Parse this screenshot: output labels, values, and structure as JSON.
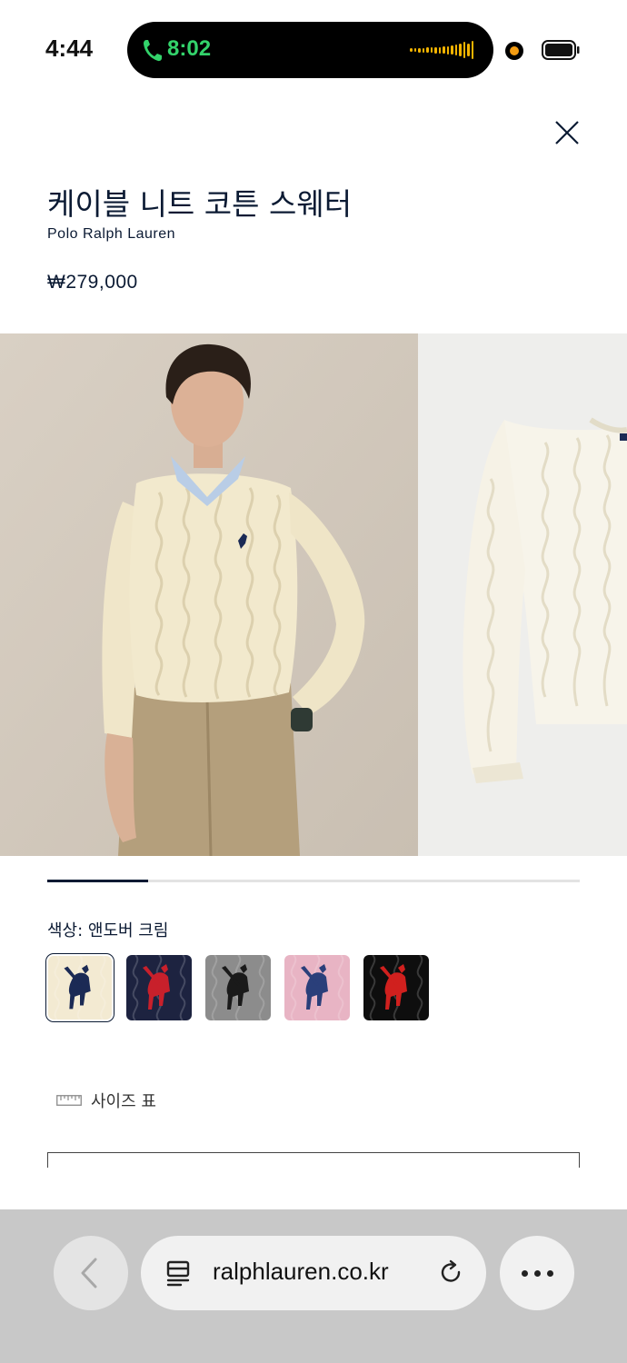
{
  "status_bar": {
    "time": "4:44",
    "call_time": "8:02"
  },
  "product": {
    "title": "케이블 니트 코튼 스웨터",
    "brand": "Polo Ralph Lauren",
    "price": "₩279,000"
  },
  "gallery": {
    "progress": 0.19
  },
  "color": {
    "label": "색상: 앤도버 크림",
    "swatches": [
      {
        "name": "cream",
        "bg": "#f3ead2",
        "pony": "#1b2a55",
        "selected": true
      },
      {
        "name": "navy",
        "bg": "#1d2340",
        "pony": "#c8202b",
        "selected": false
      },
      {
        "name": "grey",
        "bg": "#8c8c8c",
        "pony": "#1a1a1a",
        "selected": false
      },
      {
        "name": "pink",
        "bg": "#e8b4c4",
        "pony": "#2a3f7a",
        "selected": false
      },
      {
        "name": "black",
        "bg": "#0e0e0e",
        "pony": "#d0201e",
        "selected": false
      }
    ]
  },
  "size_guide": {
    "label": "사이즈 표"
  },
  "browser": {
    "url": "ralphlauren.co.kr"
  },
  "colors": {
    "navy": "#0b1a33",
    "call_green": "#33d36b",
    "waveform": "#f4b400"
  }
}
